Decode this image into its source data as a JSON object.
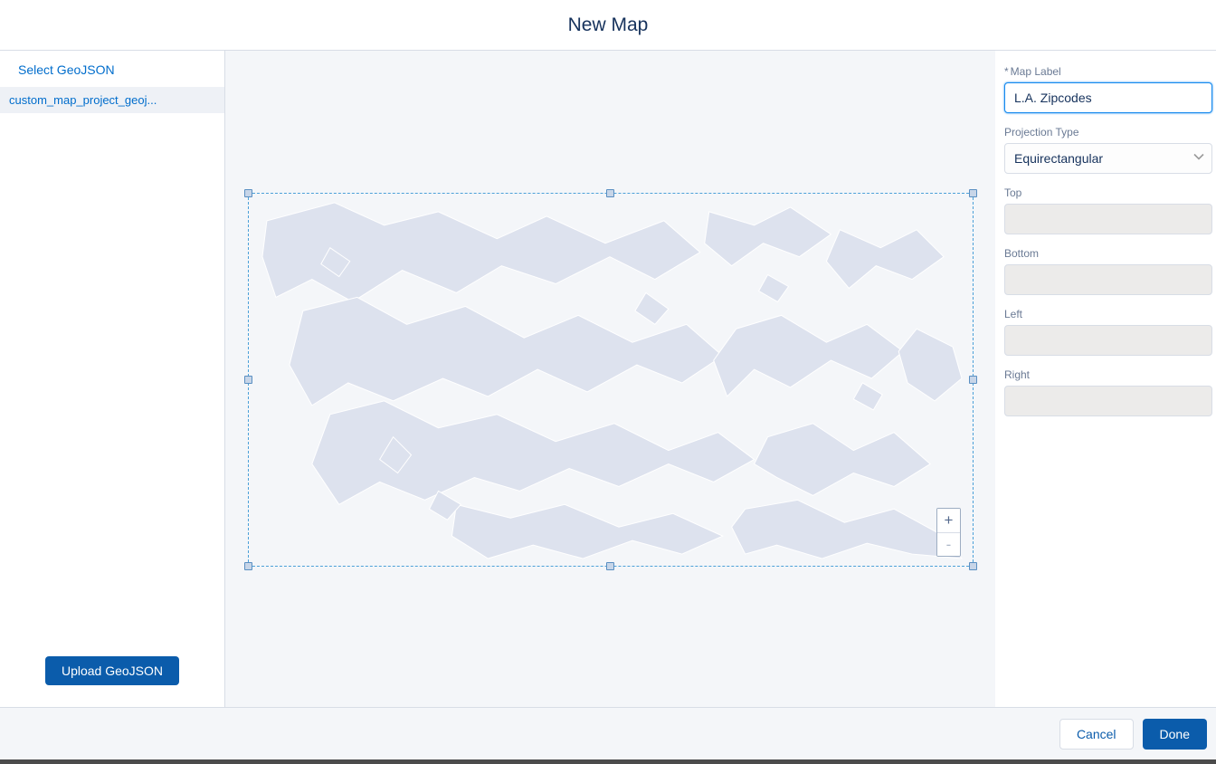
{
  "header": {
    "title": "New Map"
  },
  "sidebar": {
    "select_label": "Select GeoJSON",
    "file_name": "custom_map_project_geoj...",
    "upload_label": "Upload GeoJSON"
  },
  "zoom": {
    "in": "+",
    "out": "-"
  },
  "form": {
    "map_label": {
      "label": "Map Label",
      "required": "*",
      "value": "L.A. Zipcodes"
    },
    "projection": {
      "label": "Projection Type",
      "value": "Equirectangular"
    },
    "top": {
      "label": "Top",
      "value": ""
    },
    "bottom": {
      "label": "Bottom",
      "value": ""
    },
    "left": {
      "label": "Left",
      "value": ""
    },
    "right": {
      "label": "Right",
      "value": ""
    }
  },
  "footer": {
    "cancel": "Cancel",
    "done": "Done"
  }
}
